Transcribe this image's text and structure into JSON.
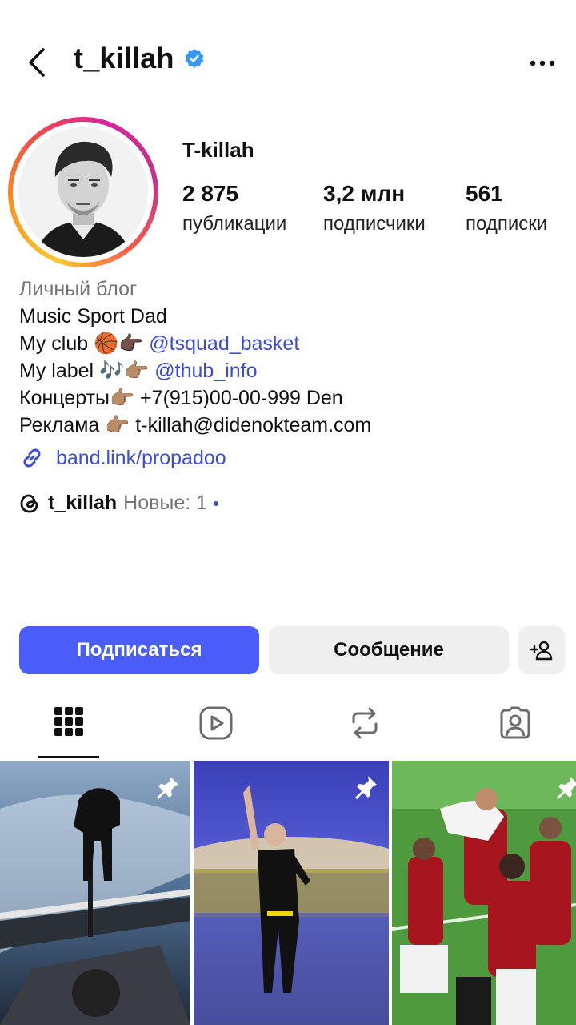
{
  "header": {
    "username": "t_killah",
    "verified": true
  },
  "profile": {
    "display_name": "T-killah",
    "stats": [
      {
        "value": "2 875",
        "label": "публикации"
      },
      {
        "value": "3,2 млн",
        "label": "подписчики"
      },
      {
        "value": "561",
        "label": "подписки"
      }
    ],
    "bio": {
      "category": "Личный блог",
      "line1": "Music Sport Dad",
      "line2_text": "My club 🏀👉🏿 ",
      "line2_mention": "@tsquad_basket",
      "line3_text": "My label 🎶👉🏽 ",
      "line3_mention": "@thub_info",
      "line4": "Концерты👉🏽 +7(915)00-00-999 Den",
      "line5": "Реклама 👉🏽 t-killah@didenokteam.com"
    },
    "link": "band.link/propadoo",
    "threads": {
      "name": "t_killah",
      "new_label": "Новые: 1"
    }
  },
  "actions": {
    "follow": "Подписаться",
    "message": "Сообщение"
  },
  "tabs": [
    "posts-grid",
    "reels",
    "reposts",
    "tagged"
  ],
  "colors": {
    "accent": "#4a5df9",
    "link": "#3b4bd6",
    "verified": "#3897f0"
  }
}
